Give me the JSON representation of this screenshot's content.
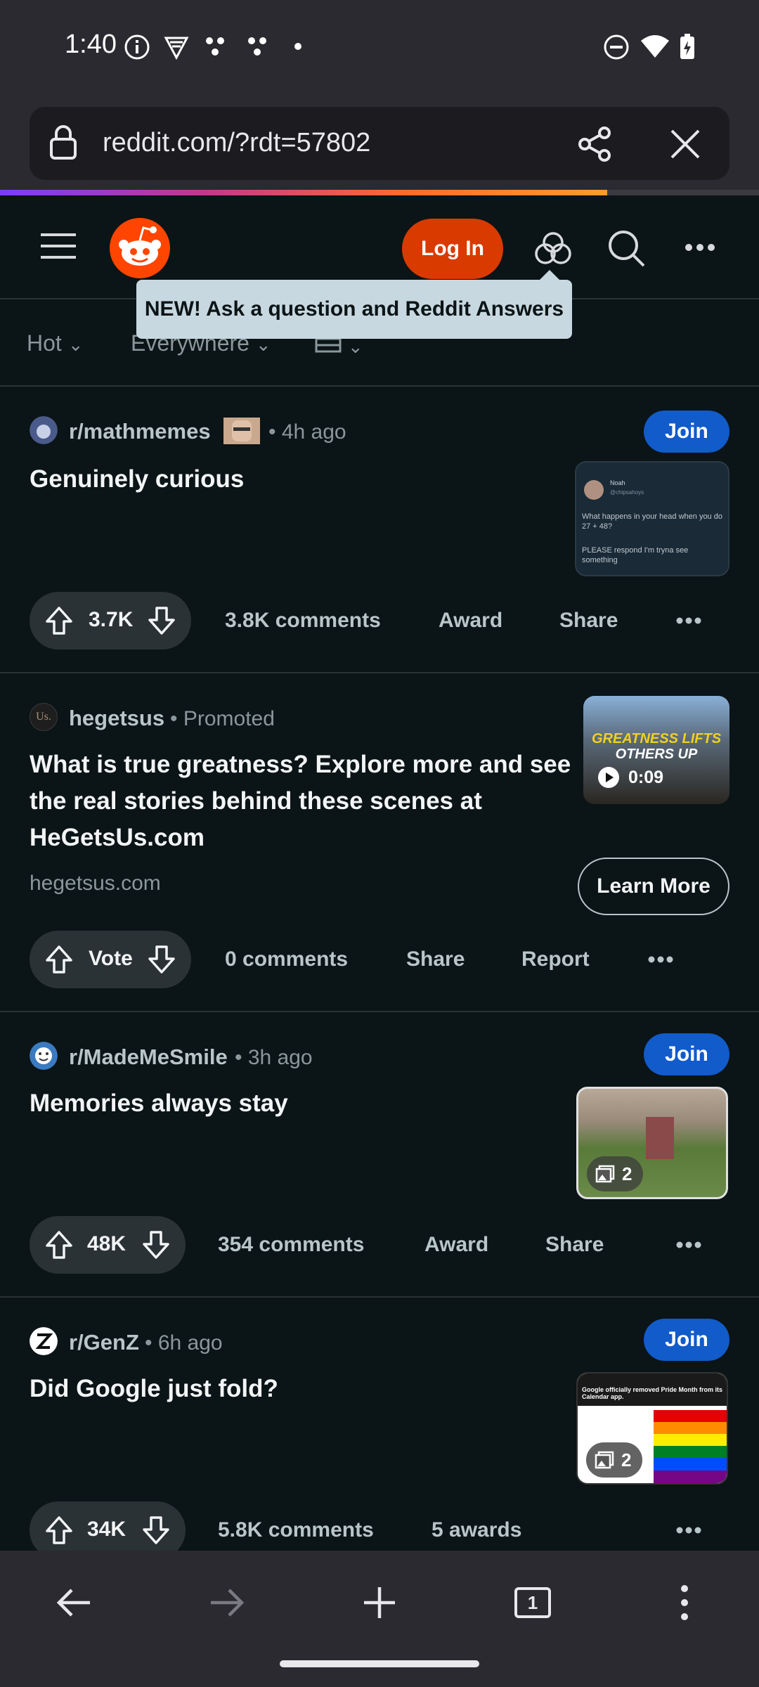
{
  "status_bar": {
    "time": "1:40"
  },
  "browser": {
    "url": "reddit.com/?rdt=57802",
    "tab_count": "1",
    "load_progress": 0.8
  },
  "header": {
    "login_label": "Log In"
  },
  "tooltip": {
    "text": "NEW! Ask a question and Reddit Answers"
  },
  "filters": {
    "sort": "Hot",
    "scope": "Everywhere"
  },
  "posts": [
    {
      "subreddit": "r/mathmemes",
      "time": "4h ago",
      "join": "Join",
      "title": "Genuinely curious",
      "votes": "3.7K",
      "comments": "3.8K comments",
      "award": "Award",
      "share": "Share",
      "thumb_lines": [
        "Noah",
        "@chipsahoys",
        "What happens in your head when you do 27 + 48?",
        "PLEASE respond I'm tryna see something"
      ]
    },
    {
      "subreddit": "hegetsus",
      "promoted": "Promoted",
      "icon_text": "Us.",
      "title": "What is true greatness? Explore more and see the real stories behind these scenes at HeGetsUs.com",
      "domain": "hegetsus.com",
      "cta": "Learn More",
      "vote_label": "Vote",
      "comments": "0 comments",
      "share": "Share",
      "report": "Report",
      "video_duration": "0:09",
      "thumb_caption_1": "GREATNESS LIFTS",
      "thumb_caption_2": "OTHERS UP"
    },
    {
      "subreddit": "r/MadeMeSmile",
      "time": "3h ago",
      "join": "Join",
      "title": "Memories always stay",
      "votes": "48K",
      "comments": "354 comments",
      "award": "Award",
      "share": "Share",
      "gallery_count": "2"
    },
    {
      "subreddit": "r/GenZ",
      "time": "6h ago",
      "join": "Join",
      "title": "Did Google just fold?",
      "votes": "34K",
      "comments": "5.8K comments",
      "awards": "5 awards",
      "gallery_count": "2",
      "thumb_text": "Google officially removed Pride Month from its Calendar app."
    }
  ],
  "colors": {
    "background": "#0b1416",
    "join": "#115bca",
    "login": "#d93a00",
    "reddit_orange": "#ff4500"
  }
}
